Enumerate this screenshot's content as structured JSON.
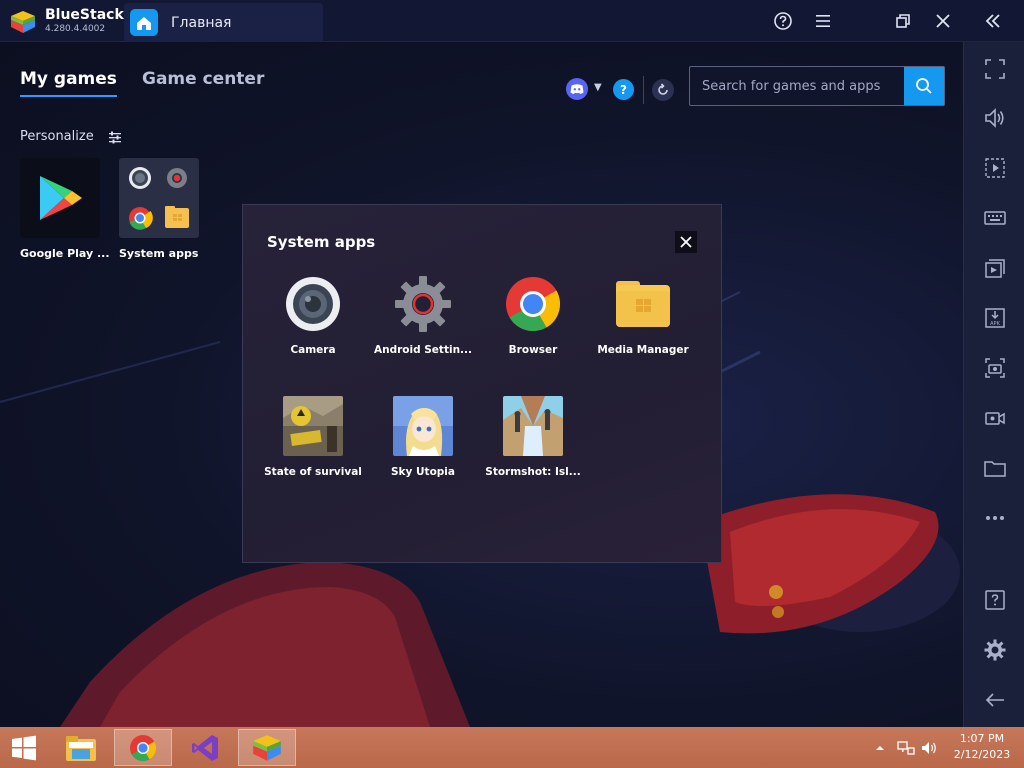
{
  "app": {
    "name": "BlueStacks",
    "version": "4.280.4.4002",
    "tab_label": "Главная"
  },
  "titlebar_buttons": [
    "help-icon",
    "menu-icon",
    "restore-icon",
    "close-icon",
    "collapse-sidebar-icon"
  ],
  "main": {
    "tabs": [
      {
        "label": "My games",
        "active": true
      },
      {
        "label": "Game center",
        "active": false
      }
    ],
    "help_glyph": "?",
    "search": {
      "placeholder": "Search for games and apps",
      "value": ""
    },
    "personalize_label": "Personalize",
    "apps": [
      {
        "label": "Google Play ...",
        "icon": "google-play-icon"
      },
      {
        "label": "System apps",
        "icon": "folder-icon"
      }
    ]
  },
  "popup": {
    "title": "System apps",
    "apps": [
      {
        "label": "Camera",
        "icon": "camera-icon"
      },
      {
        "label": "Android Settin...",
        "icon": "settings-gear-icon"
      },
      {
        "label": "Browser",
        "icon": "chrome-icon"
      },
      {
        "label": "Media Manager",
        "icon": "media-folder-icon"
      },
      {
        "label": "State of survival",
        "icon": "game-thumbnail"
      },
      {
        "label": "Sky Utopia",
        "icon": "game-thumbnail"
      },
      {
        "label": "Stormshot: Isl...",
        "icon": "game-thumbnail"
      }
    ]
  },
  "sidebar_tools": [
    "fullscreen-icon",
    "volume-icon",
    "screen-capture-icon",
    "keyboard-icon",
    "media-icon",
    "apk-install-icon",
    "screenshot-icon",
    "record-icon",
    "folder-icon",
    "more-icon",
    "help-icon",
    "settings-icon",
    "back-icon"
  ],
  "taskbar": {
    "time": "1:07 PM",
    "date": "2/12/2023"
  },
  "colors": {
    "accent": "#1598f0",
    "titlebar": "#121833",
    "sidebar": "#1a1f3a",
    "popup": "#231f35",
    "taskbar": "#c2714e"
  }
}
